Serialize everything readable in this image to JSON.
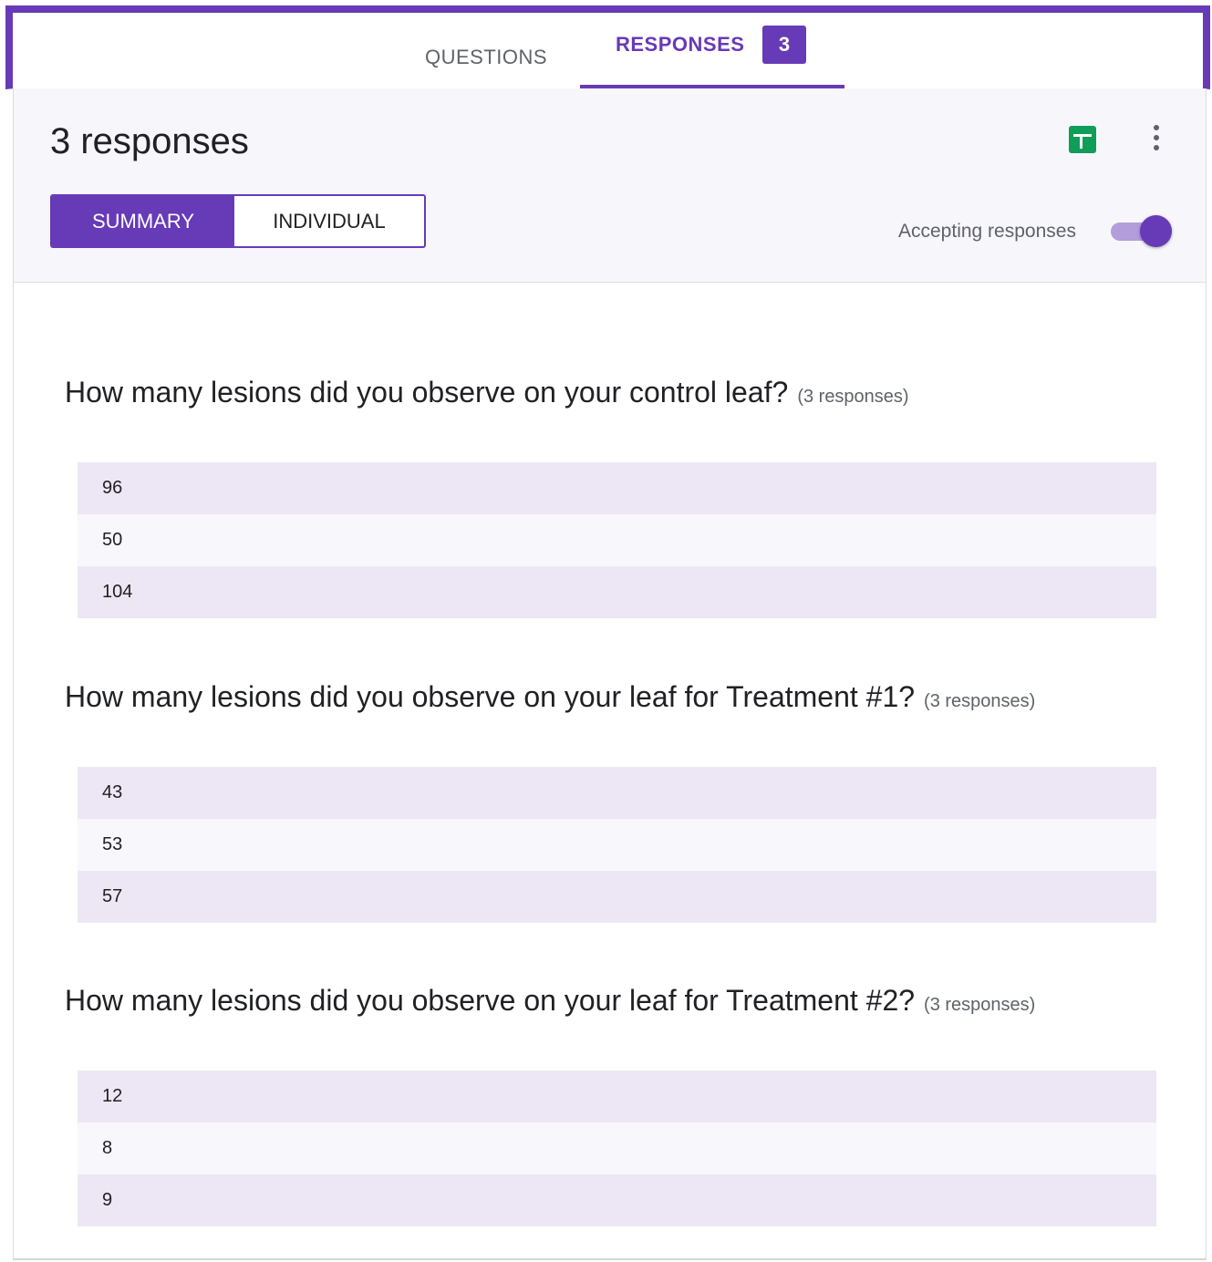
{
  "tabs": {
    "questions_label": "QUESTIONS",
    "responses_label": "RESPONSES",
    "responses_count": "3"
  },
  "header": {
    "title": "3 responses",
    "summary_label": "SUMMARY",
    "individual_label": "INDIVIDUAL",
    "accepting_label": "Accepting responses",
    "accepting_on": true
  },
  "icons": {
    "sheets": "google-sheets-icon",
    "more": "more-vert-icon"
  },
  "colors": {
    "accent": "#673ab7",
    "sheets_green": "#0f9d58",
    "row_shaded": "#ede7f5"
  },
  "questions": [
    {
      "title": "How many lesions did you observe on your control leaf?",
      "count": "(3 responses)",
      "answers": [
        "96",
        "50",
        "104"
      ]
    },
    {
      "title": "How many lesions did you observe on your leaf for Treatment #1?",
      "count": "(3 responses)",
      "answers": [
        "43",
        "53",
        "57"
      ]
    },
    {
      "title": "How many lesions did you observe on your leaf for Treatment #2?",
      "count": "(3 responses)",
      "answers": [
        "12",
        "8",
        "9"
      ]
    }
  ]
}
